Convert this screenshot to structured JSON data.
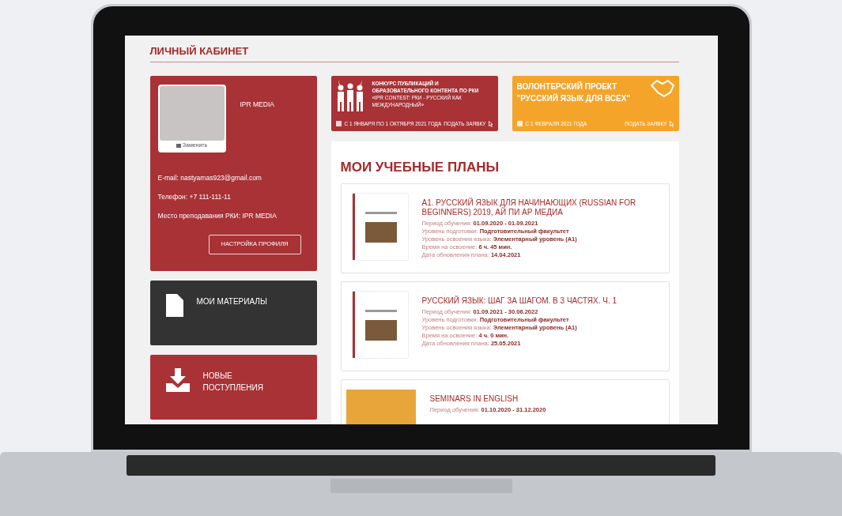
{
  "header": {
    "title": "ЛИЧНЫЙ КАБИНЕТ"
  },
  "profile": {
    "photo_button": "Заменить",
    "name": "IPR MEDIA",
    "details": [
      "E-mail: nastyamas923@gmail.com",
      "Телефон: +7 111-111-11",
      "Место преподавания РКИ: IPR MEDIA"
    ],
    "settings_button": "НАСТРОЙКА ПРОФИЛЯ"
  },
  "menu": [
    {
      "kind": "materials",
      "label": "МОИ МАТЕРИАЛЫ",
      "color": "#333333"
    },
    {
      "kind": "new",
      "label": "НОВЫЕ ПОСТУПЛЕНИЯ",
      "color": "#a83236"
    }
  ],
  "banners": [
    {
      "kind": "contest",
      "color": "#a83236",
      "title": "**КОНКУРС ПУБЛИКАЦИЙ И ОБРАЗОВАТЕЛЬНОГО КОНТЕНТА ПО РКИ** «IPR CONTEST: РКИ - РУССКИЙ КАК МЕЖДУНАРОДНЫЙ»",
      "date": "С 1 ЯНВАРЯ ПО 1 ОКТЯБРЯ 2021 ГОДА",
      "link": "ПОДАТЬ ЗАЯВКУ"
    },
    {
      "kind": "volunteer",
      "color": "#f5a42a",
      "title": "ВОЛОНТЕРСКИЙ ПРОЕКТ \"РУССКИЙ ЯЗЫК ДЛЯ ВСЕХ\"",
      "date": "С 1 ФЕВРАЛЯ 2021 ГОДА",
      "link": "ПОДАТЬ ЗАЯВКУ"
    }
  ],
  "plans": {
    "title": "МОИ УЧЕБНЫЕ ПЛАНЫ",
    "items": [
      {
        "kind": "book",
        "title": "А1. РУССКИЙ ЯЗЫК ДЛЯ НАЧИНАЮЩИХ (RUSSIAN FOR BEGINNERS) 2019, АЙ ПИ АР МЕДИА",
        "fields": [
          {
            "label": "Период обучения:",
            "value": "01.09.2020 - 01.09.2021"
          },
          {
            "label": "Уровень подготовки:",
            "value": "Подготовительный факультет"
          },
          {
            "label": "Уровень освоения языка:",
            "value": "Элементарный уровень (А1)"
          },
          {
            "label": "Время на освоение:",
            "value": "6 ч. 45 мин."
          },
          {
            "label": "Дата обновления плана:",
            "value": "14.04.2021"
          }
        ]
      },
      {
        "kind": "book",
        "title": "РУССКИЙ ЯЗЫК: ШАГ ЗА ШАГОМ. В 3 ЧАСТЯХ. Ч. 1",
        "fields": [
          {
            "label": "Период обучения:",
            "value": "01.09.2021 - 30.06.2022"
          },
          {
            "label": "Уровень подготовки:",
            "value": "Подготовительный факультет"
          },
          {
            "label": "Уровень освоения языка:",
            "value": "Элементарный уровень (А1)"
          },
          {
            "label": "Время на освоение:",
            "value": "4 ч. 0 мин."
          },
          {
            "label": "Дата обновления плана:",
            "value": "25.05.2021"
          }
        ]
      },
      {
        "kind": "photo",
        "title": "SEMINARS IN ENGLISH",
        "fields": [
          {
            "label": "Период обучения:",
            "value": "01.10.2020 - 31.12.2020"
          }
        ]
      }
    ]
  }
}
